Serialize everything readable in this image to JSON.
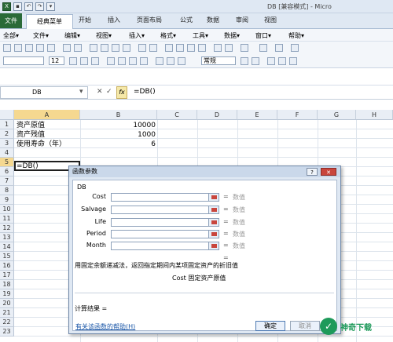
{
  "window": {
    "title": "DB [兼容模式] - Micro"
  },
  "ribbon": {
    "file_tab": "文件",
    "tabs": [
      "经典菜单",
      "开始",
      "插入",
      "页面布局",
      "公式",
      "数据",
      "审阅",
      "视图"
    ]
  },
  "classic_menu": [
    "全部▾",
    "文件▾",
    "编辑▾",
    "视图▾",
    "插入▾",
    "格式▾",
    "工具▾",
    "数据▾",
    "窗口▾",
    "帮助▾"
  ],
  "toolbar": {
    "font_size": "12",
    "number_format": "常规"
  },
  "formula_bar": {
    "name_box": "DB",
    "formula": "=DB()",
    "fx": "fx"
  },
  "sheet": {
    "columns": [
      "A",
      "B",
      "C",
      "D",
      "E",
      "F",
      "G",
      "H"
    ],
    "rows": [
      "1",
      "2",
      "3",
      "4",
      "5",
      "6",
      "7",
      "8",
      "9",
      "10",
      "11",
      "12",
      "13",
      "14",
      "15",
      "16",
      "17",
      "18",
      "19",
      "20",
      "21",
      "22",
      "23"
    ],
    "cells": {
      "a1": "资产原值",
      "b1": "10000",
      "a2": "资产残值",
      "b2": "1000",
      "a3": "使用寿命（年）",
      "b3": "6",
      "a5": "=DB()"
    }
  },
  "dialog": {
    "title": "函数参数",
    "function_name": "DB",
    "args": [
      {
        "label": "Cost",
        "value_hint": "数值"
      },
      {
        "label": "Salvage",
        "value_hint": "数值"
      },
      {
        "label": "Life",
        "value_hint": "数值"
      },
      {
        "label": "Period",
        "value_hint": "数值"
      },
      {
        "label": "Month",
        "value_hint": "数值"
      }
    ],
    "eq": "=",
    "description": "用固定余额递减法，返回指定期间内某项固定资产的折旧值",
    "arg_description": "Cost  固定资产原值",
    "result_label": "计算结果 =",
    "help_link": "有关该函数的帮助(H)",
    "ok_label": "确定",
    "cancel_label": "取消"
  },
  "watermark": {
    "text": "神奇下载"
  }
}
